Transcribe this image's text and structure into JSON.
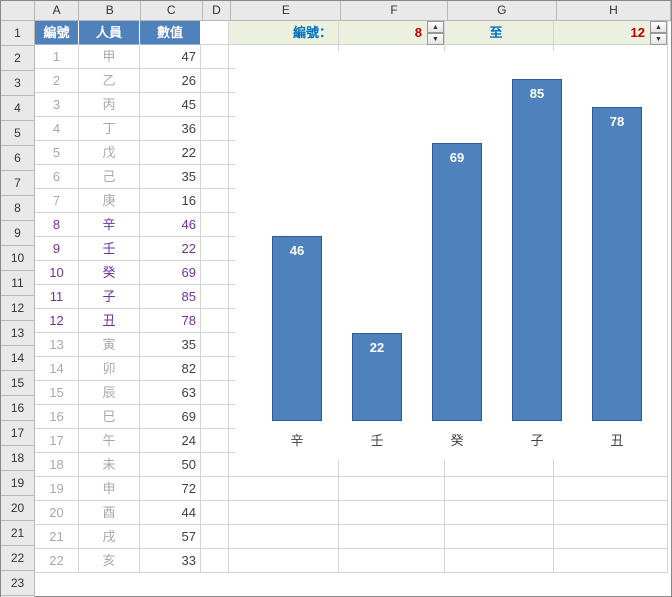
{
  "columns": [
    "A",
    "B",
    "C",
    "D",
    "E",
    "F",
    "G",
    "H"
  ],
  "headers": {
    "A": "編號",
    "B": "人員",
    "C": "數值"
  },
  "control": {
    "label_from": "編號：",
    "value_from": "8",
    "label_to": "至",
    "value_to": "12"
  },
  "highlight_from": 8,
  "highlight_to": 12,
  "rows": [
    {
      "n": "1",
      "a": "1",
      "b": "甲",
      "c": "47"
    },
    {
      "n": "2",
      "a": "2",
      "b": "乙",
      "c": "26"
    },
    {
      "n": "3",
      "a": "3",
      "b": "丙",
      "c": "45"
    },
    {
      "n": "4",
      "a": "4",
      "b": "丁",
      "c": "36"
    },
    {
      "n": "5",
      "a": "5",
      "b": "戊",
      "c": "22"
    },
    {
      "n": "6",
      "a": "6",
      "b": "己",
      "c": "35"
    },
    {
      "n": "7",
      "a": "7",
      "b": "庚",
      "c": "16"
    },
    {
      "n": "8",
      "a": "8",
      "b": "辛",
      "c": "46"
    },
    {
      "n": "9",
      "a": "9",
      "b": "壬",
      "c": "22"
    },
    {
      "n": "10",
      "a": "10",
      "b": "癸",
      "c": "69"
    },
    {
      "n": "11",
      "a": "11",
      "b": "子",
      "c": "85"
    },
    {
      "n": "12",
      "a": "12",
      "b": "丑",
      "c": "78"
    },
    {
      "n": "13",
      "a": "13",
      "b": "寅",
      "c": "35"
    },
    {
      "n": "14",
      "a": "14",
      "b": "卯",
      "c": "82"
    },
    {
      "n": "15",
      "a": "15",
      "b": "辰",
      "c": "63"
    },
    {
      "n": "16",
      "a": "16",
      "b": "巳",
      "c": "69"
    },
    {
      "n": "17",
      "a": "17",
      "b": "午",
      "c": "24"
    },
    {
      "n": "18",
      "a": "18",
      "b": "未",
      "c": "50"
    },
    {
      "n": "19",
      "a": "19",
      "b": "申",
      "c": "72"
    },
    {
      "n": "20",
      "a": "20",
      "b": "酉",
      "c": "44"
    },
    {
      "n": "21",
      "a": "21",
      "b": "戌",
      "c": "57"
    },
    {
      "n": "22",
      "a": "22",
      "b": "亥",
      "c": "33"
    }
  ],
  "chart_data": {
    "type": "bar",
    "categories": [
      "辛",
      "壬",
      "癸",
      "子",
      "丑"
    ],
    "values": [
      46,
      22,
      69,
      85,
      78
    ],
    "ylim": [
      0,
      90
    ],
    "title": "",
    "xlabel": "",
    "ylabel": ""
  }
}
